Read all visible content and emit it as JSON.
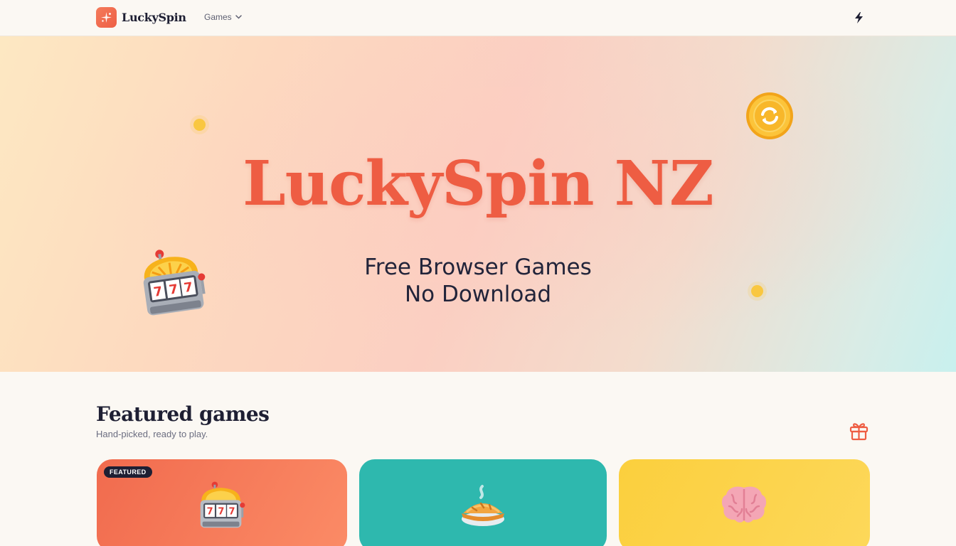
{
  "header": {
    "brand": "LuckySpin",
    "nav_games": "Games",
    "logo_icon": "sparkle-icon",
    "nav_chevron": "chevron-down-icon",
    "right_icon": "bolt-icon"
  },
  "hero": {
    "title": "LuckySpin NZ",
    "subtitle_line1": "Free Browser Games",
    "subtitle_line2": "No Download",
    "decor": [
      "coin-icon",
      "slot-machine-icon"
    ],
    "accent": "#ee5d43"
  },
  "featured": {
    "title": "Featured games",
    "subtitle": "Hand-picked, ready to play.",
    "gift_icon": "gift-icon",
    "cards": [
      {
        "badge": "FEATURED",
        "icon": "slot-machine-icon",
        "color": "#f16b4e"
      },
      {
        "icon": "pie-icon",
        "color": "#2eb8ae"
      },
      {
        "icon": "brain-icon",
        "color": "#fbcf3d"
      }
    ]
  }
}
